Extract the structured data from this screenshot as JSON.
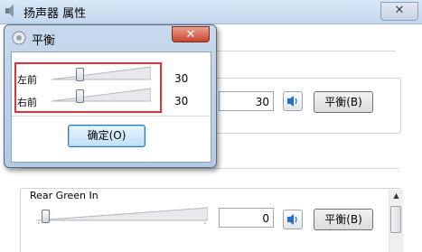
{
  "main_window": {
    "title": "扬声器 属性",
    "close_glyph": "✕",
    "channels": [
      {
        "name": "",
        "value": "30",
        "balance_label": "平衡(B)"
      },
      {
        "name": "Rear Green In",
        "value": "0",
        "balance_label": "平衡(B)"
      }
    ]
  },
  "balance_dialog": {
    "title": "平衡",
    "close_glyph": "✕",
    "channels": [
      {
        "label": "左前",
        "value": "30"
      },
      {
        "label": "右前",
        "value": "30"
      }
    ],
    "ok_label": "确定(O)"
  },
  "levels": {
    "dialog_left_front": 0.3,
    "dialog_right_front": 0.3,
    "main_channel_1": 0.3,
    "main_rear_green_in": 0.0
  },
  "colors": {
    "highlight": "#e0323a",
    "close_red": "#c8452c",
    "title_blue": "#c3d7ee"
  },
  "icons": [
    "speaker-icon",
    "mute-speaker-icon",
    "close-icon",
    "scroll-up-arrow-icon"
  ]
}
